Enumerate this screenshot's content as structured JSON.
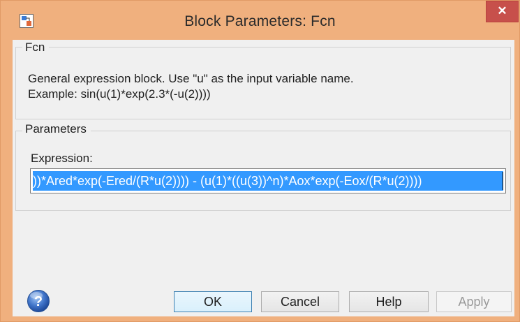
{
  "window": {
    "title": "Block Parameters: Fcn",
    "close_glyph": "✕",
    "title_bar_color": "#f0b07e",
    "close_button_color": "#c7504b"
  },
  "fcn_group": {
    "legend": "Fcn",
    "description_line1": "General expression block. Use \"u\" as the input variable name.",
    "description_line2": "Example: sin(u(1)*exp(2.3*(-u(2))))"
  },
  "parameters_group": {
    "legend": "Parameters",
    "expression_label": "Expression:",
    "expression_visible_value": "))*Ared*exp(-Ered/(R*u(2)))) - (u(1)*((u(3))^n)*Aox*exp(-Eox/(R*u(2))))",
    "selection_color": "#3399ff"
  },
  "buttons": {
    "ok": "OK",
    "cancel": "Cancel",
    "help": "Help",
    "apply": "Apply"
  },
  "icons": {
    "app": "simulink-app-icon",
    "help": "question-mark-help-icon"
  }
}
